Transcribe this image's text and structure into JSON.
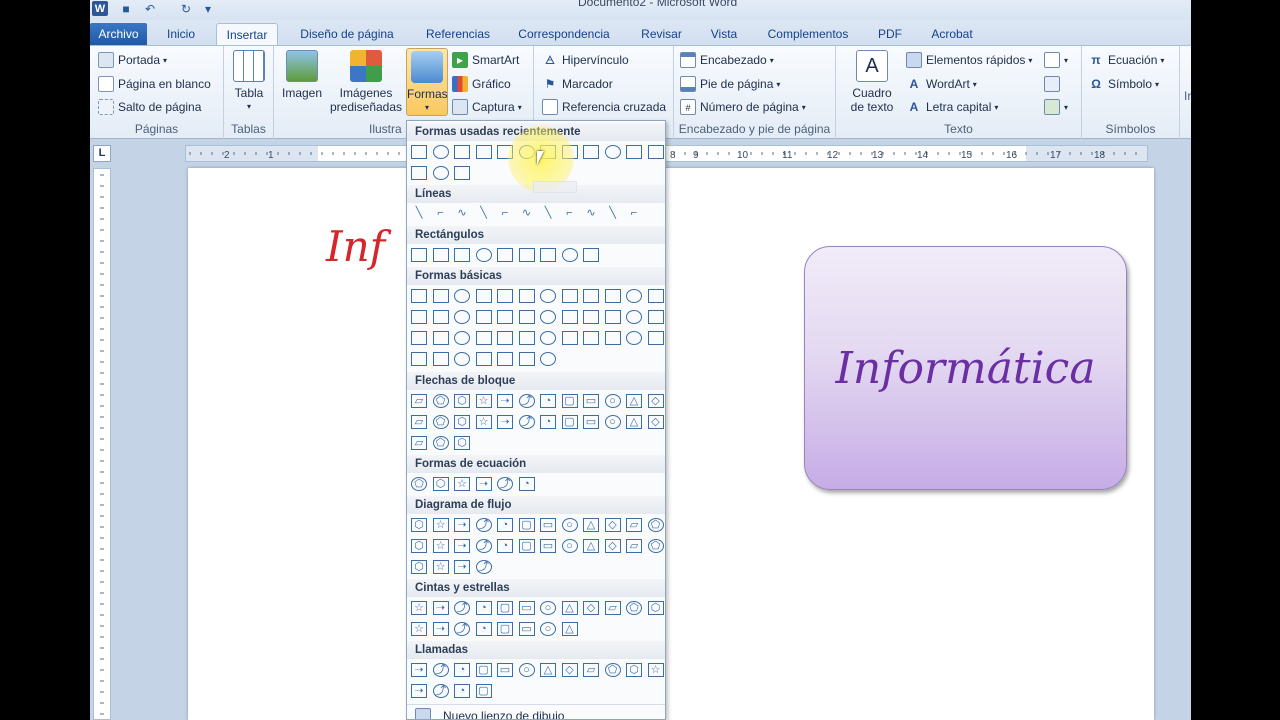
{
  "window": {
    "title": "Documento2 - Microsoft Word"
  },
  "tabs": [
    "Archivo",
    "Inicio",
    "Insertar",
    "Diseño de página",
    "Referencias",
    "Correspondencia",
    "Revisar",
    "Vista",
    "Complementos",
    "PDF",
    "Acrobat"
  ],
  "active_tab": "Insertar",
  "ribbon": {
    "paginas": {
      "label": "Páginas",
      "items": [
        "Portada",
        "Página en blanco",
        "Salto de página"
      ]
    },
    "tablas": {
      "label": "Tablas",
      "tabla": "Tabla"
    },
    "ilustraciones": {
      "label": "Ilustra",
      "imagen": "Imagen",
      "imagenes_line1": "Imágenes",
      "imagenes_line2": "prediseñadas",
      "formas": "Formas",
      "smartart": "SmartArt",
      "grafico": "Gráfico",
      "captura": "Captura"
    },
    "vinculos": {
      "hipervinculo": "Hipervínculo",
      "marcador": "Marcador",
      "referencia": "Referencia cruzada"
    },
    "encabezado": {
      "label": "Encabezado y pie de página",
      "items": [
        "Encabezado",
        "Pie de página",
        "Número de página"
      ]
    },
    "texto": {
      "label": "Texto",
      "cuadro_line1": "Cuadro",
      "cuadro_line2": "de texto",
      "items": [
        "Elementos rápidos",
        "WordArt",
        "Letra capital"
      ]
    },
    "simbolos": {
      "label": "Símbolos",
      "items": [
        "Ecuación",
        "Símbolo"
      ]
    },
    "cut_label": "Ir"
  },
  "ruler": {
    "numbers": [
      "2",
      "1",
      "8",
      "9",
      "10",
      "11",
      "12",
      "13",
      "14",
      "15",
      "16",
      "17",
      "18"
    ]
  },
  "document": {
    "partial_text": "Inf",
    "shape_text": "Informática"
  },
  "shapes_menu": {
    "sections": [
      "Formas usadas recientemente",
      "Líneas",
      "Rectángulos",
      "Formas básicas",
      "Flechas de bloque",
      "Formas de ecuación",
      "Diagrama de flujo",
      "Cintas y estrellas",
      "Llamadas"
    ],
    "footer": "Nuevo lienzo de dibujo"
  },
  "colors": {
    "accent": "#2b5797",
    "file_tab": "#1f5aa8",
    "shape_fill": "#c6ace6",
    "shape_text": "#6b2fa3",
    "ink": "#d4262b"
  }
}
